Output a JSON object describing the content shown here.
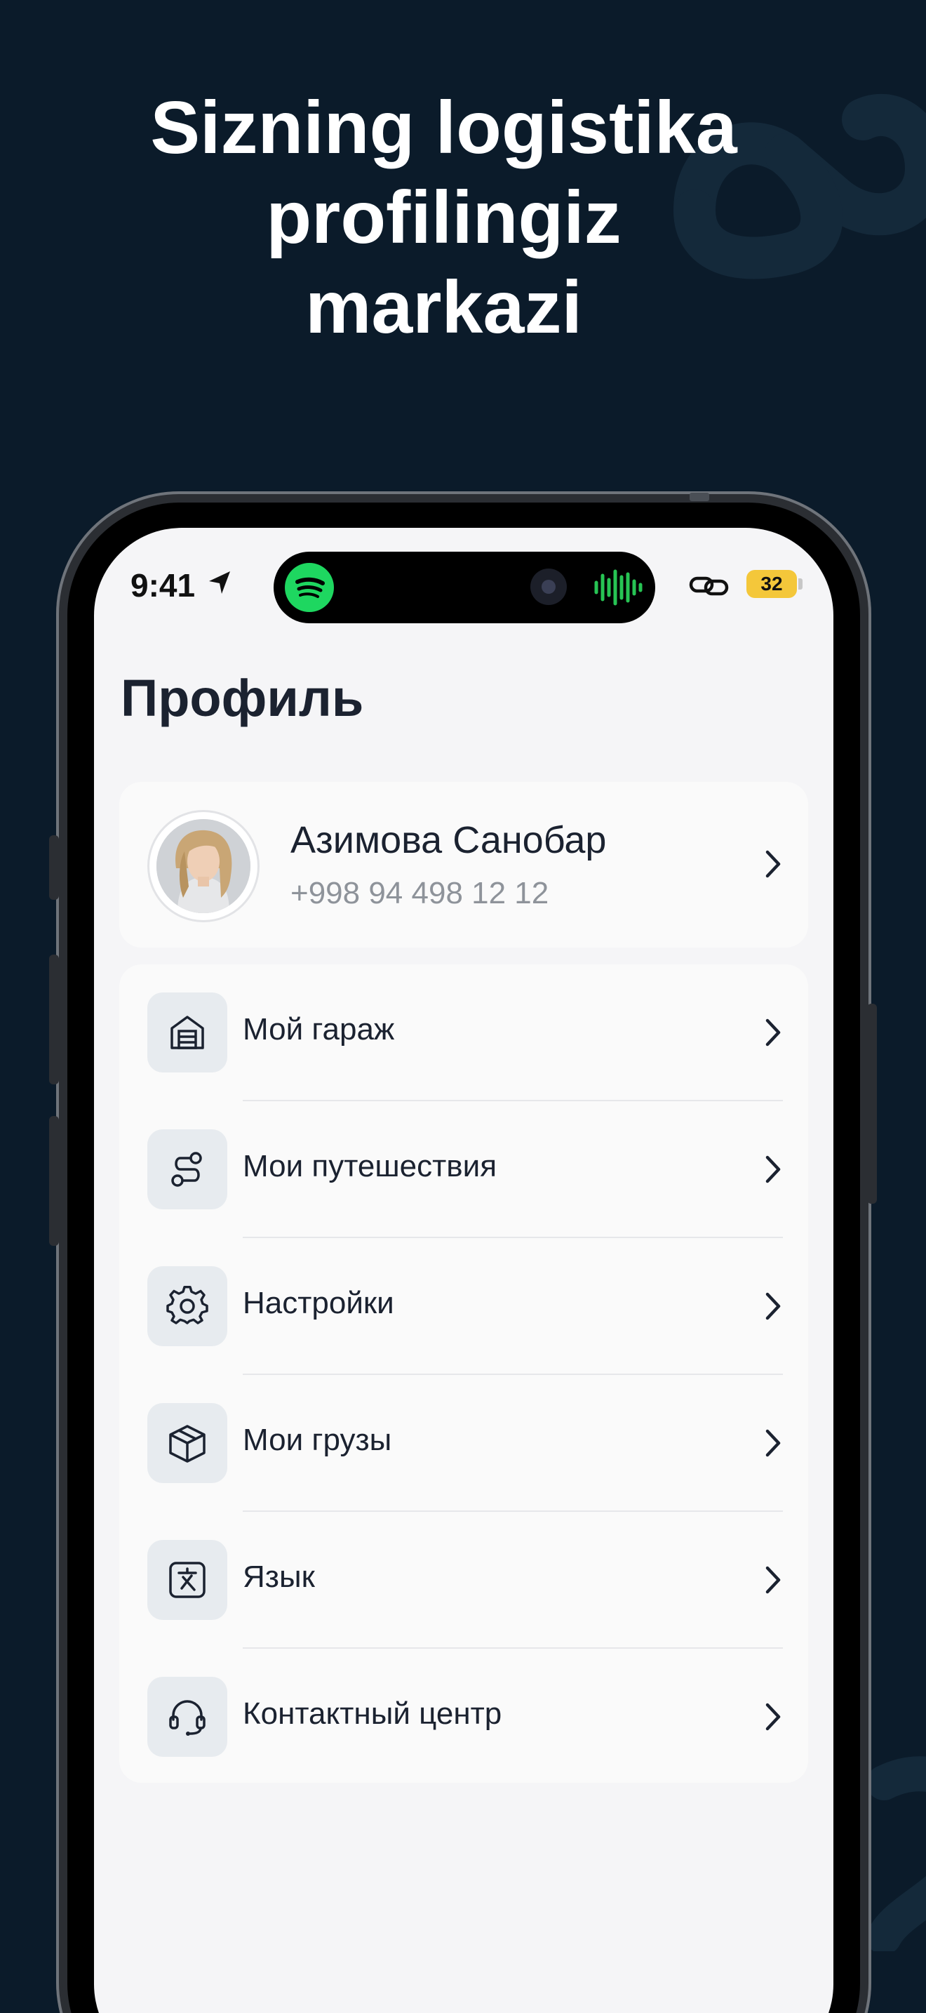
{
  "headline": {
    "lines": [
      "Sizning logistika",
      "profilingiz",
      "markazi"
    ]
  },
  "status_bar": {
    "time": "9:41",
    "battery": "32",
    "icons": [
      "location-arrow-icon",
      "spotify-icon",
      "audio-wave-icon",
      "link-icon",
      "battery-icon"
    ]
  },
  "screen": {
    "title": "Профиль",
    "profile": {
      "name": "Азимова Санобар",
      "phone": "+998 94 498 12 12"
    },
    "menu": [
      {
        "label": "Мой гараж",
        "icon": "garage-icon"
      },
      {
        "label": "Мои путешествия",
        "icon": "route-icon"
      },
      {
        "label": "Настройки",
        "icon": "gear-icon"
      },
      {
        "label": "Мои грузы",
        "icon": "package-icon"
      },
      {
        "label": "Язык",
        "icon": "translate-icon"
      },
      {
        "label": "Контактный центр",
        "icon": "headset-icon"
      }
    ]
  },
  "colors": {
    "background": "#0b1b2a",
    "screen": "#f5f5f7",
    "card": "#fafafa",
    "icon_box": "#e7ebef",
    "spotify": "#1ed760",
    "battery": "#f4c73a"
  }
}
